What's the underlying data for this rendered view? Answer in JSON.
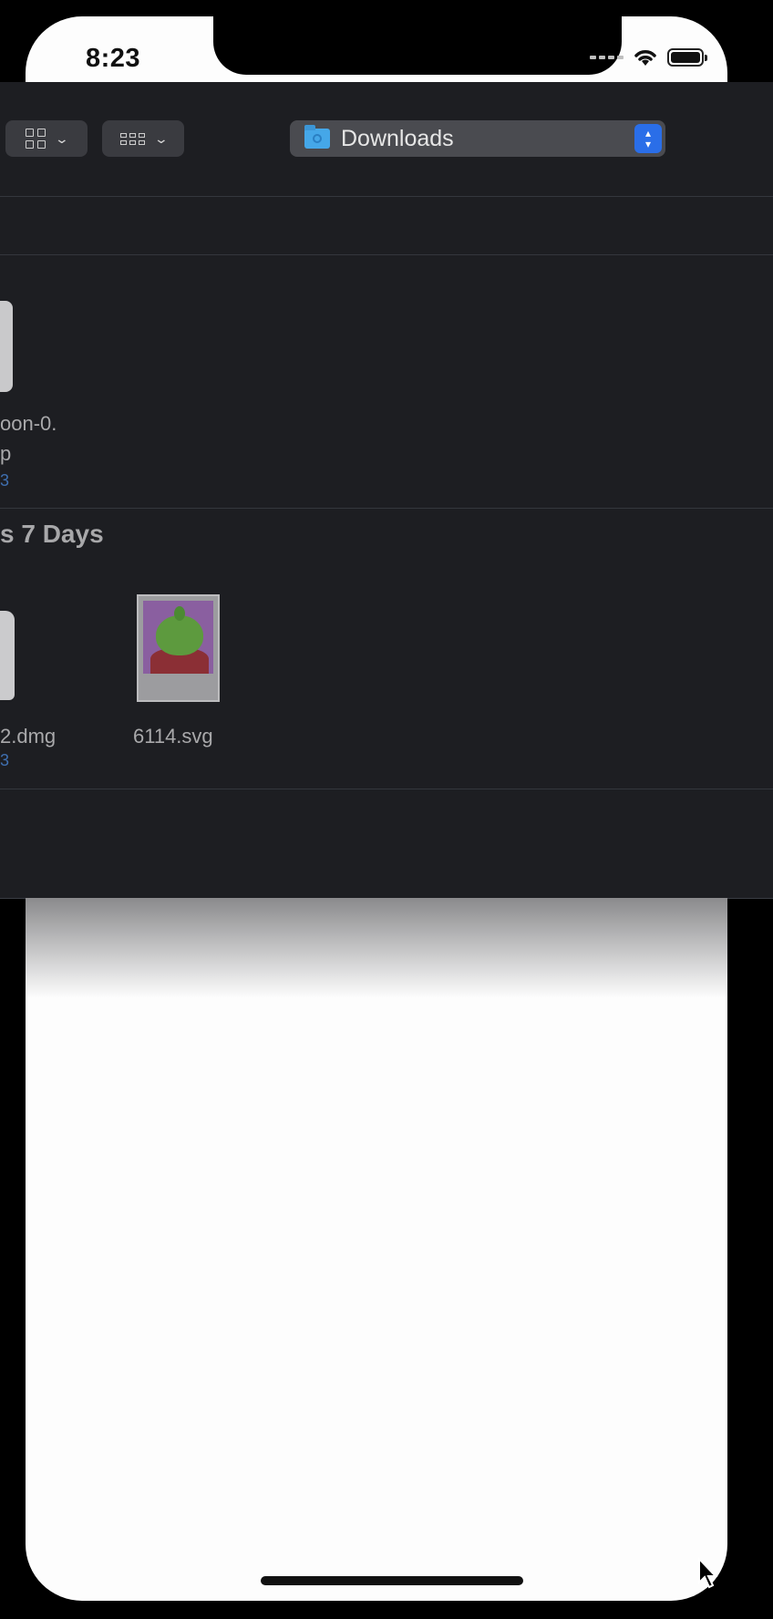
{
  "status_bar": {
    "time": "8:23",
    "icons": [
      "signal-icon",
      "wifi-icon",
      "battery-icon"
    ]
  },
  "toolbar": {
    "view_button_1_icon": "icon-view-grid",
    "view_button_2_icon": "gallery-view-icon",
    "location_label": "Downloads",
    "location_icon": "folder-icon"
  },
  "files": {
    "top_item": {
      "name_line1": "oon-0.",
      "name_line2": "p",
      "size": "3"
    },
    "section_title": "s 7 Days",
    "recent_items": [
      {
        "name": "2.dmg",
        "size": "3"
      },
      {
        "name": "6114.svg"
      }
    ]
  },
  "colors": {
    "finder_bg": "#1d1e22",
    "accent_blue": "#2a6ee8",
    "folder_blue": "#45a7e8"
  }
}
